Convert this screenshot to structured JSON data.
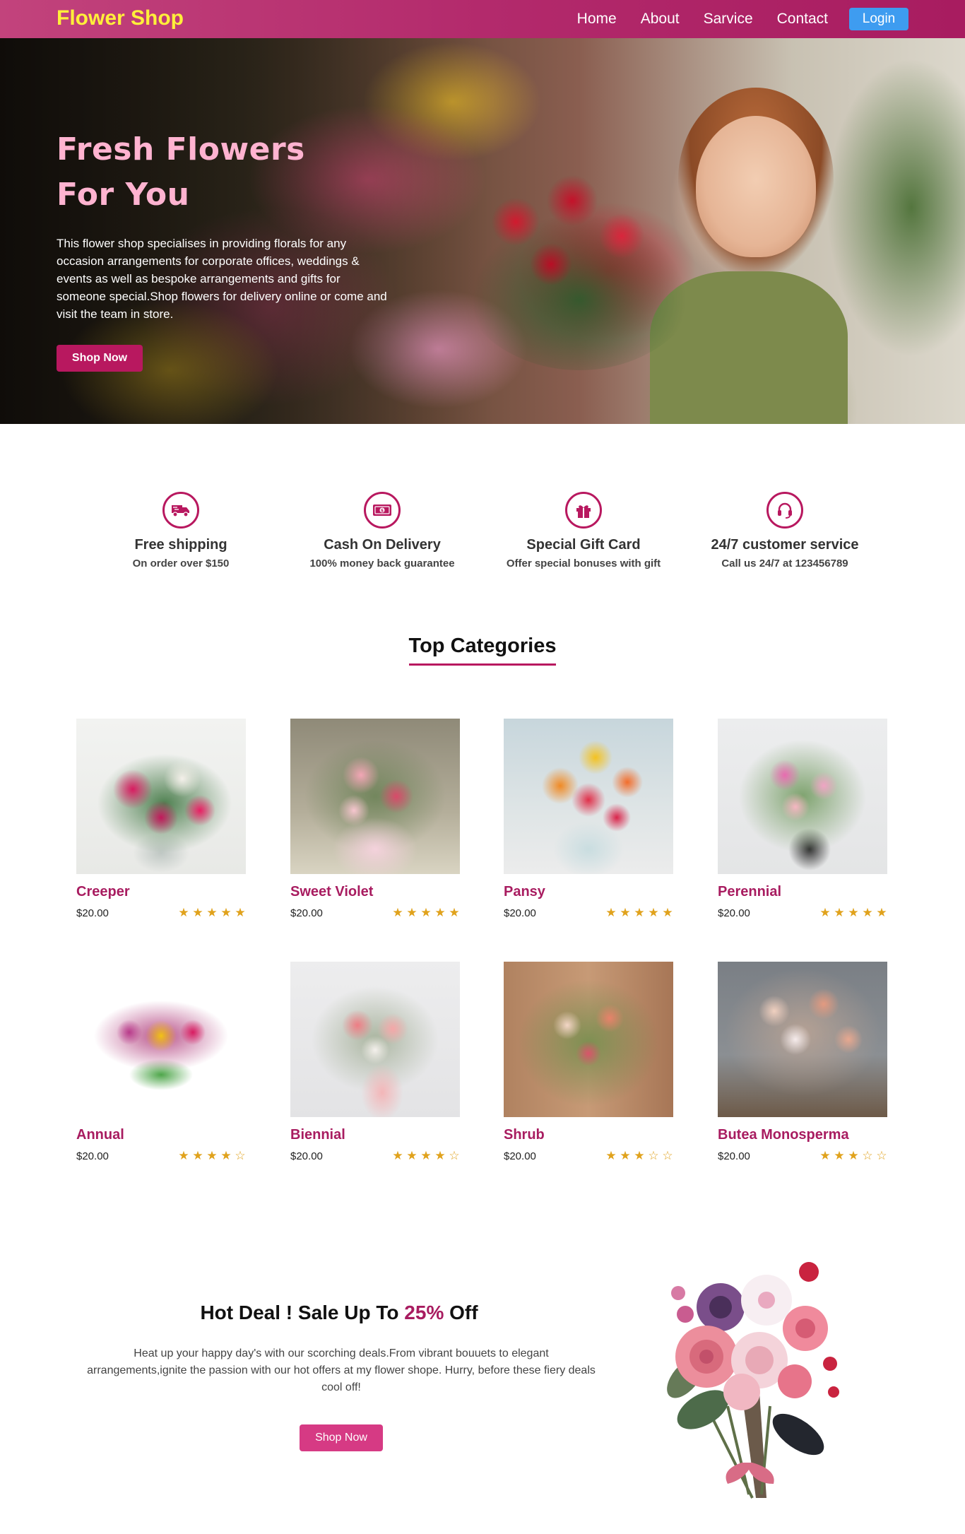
{
  "navbar": {
    "brand": "Flower Shop",
    "links": [
      "Home",
      "About",
      "Sarvice",
      "Contact"
    ],
    "login": "Login"
  },
  "hero": {
    "title_line1": "Fresh Flowers",
    "title_line2": "For You",
    "text": "This flower shop specialises in providing florals for any occasion arrangements for corporate offices, weddings & events as well as bespoke arrangements and gifts for someone special.Shop flowers for delivery online or come and visit the team in store.",
    "button": "Shop Now"
  },
  "features": [
    {
      "icon": "truck-icon",
      "title": "Free shipping",
      "subtitle": "On order over $150"
    },
    {
      "icon": "cash-icon",
      "title": "Cash On Delivery",
      "subtitle": "100% money back guarantee"
    },
    {
      "icon": "gift-icon",
      "title": "Special Gift Card",
      "subtitle": "Offer special bonuses with gift"
    },
    {
      "icon": "headset-icon",
      "title": "24/7 customer service",
      "subtitle": "Call us 24/7 at 123456789"
    }
  ],
  "categories": {
    "title": "Top Categories",
    "items": [
      {
        "name": "Creeper",
        "price": "$20.00",
        "rating": 5
      },
      {
        "name": "Sweet Violet",
        "price": "$20.00",
        "rating": 5
      },
      {
        "name": "Pansy",
        "price": "$20.00",
        "rating": 5
      },
      {
        "name": "Perennial",
        "price": "$20.00",
        "rating": 5
      },
      {
        "name": "Annual",
        "price": "$20.00",
        "rating": 4
      },
      {
        "name": "Biennial",
        "price": "$20.00",
        "rating": 4
      },
      {
        "name": "Shrub",
        "price": "$20.00",
        "rating": 3
      },
      {
        "name": "Butea Monosperma",
        "price": "$20.00",
        "rating": 3
      }
    ]
  },
  "deal": {
    "title_pre": "Hot Deal ! Sale Up To ",
    "title_pct": "25%",
    "title_post": " Off",
    "text": "Heat up your happy day's with our scorching deals.From vibrant bouuets to elegant arrangements,ignite the passion with our hot offers at my flower shope. Hurry, before these fiery deals cool off!",
    "button": "Shop Now"
  },
  "colors": {
    "accent": "#b8185f",
    "brand_text": "#ffef3a",
    "hero_title": "#ffb3d0",
    "login_button": "#3e9cf0",
    "star": "#e0a21c"
  }
}
